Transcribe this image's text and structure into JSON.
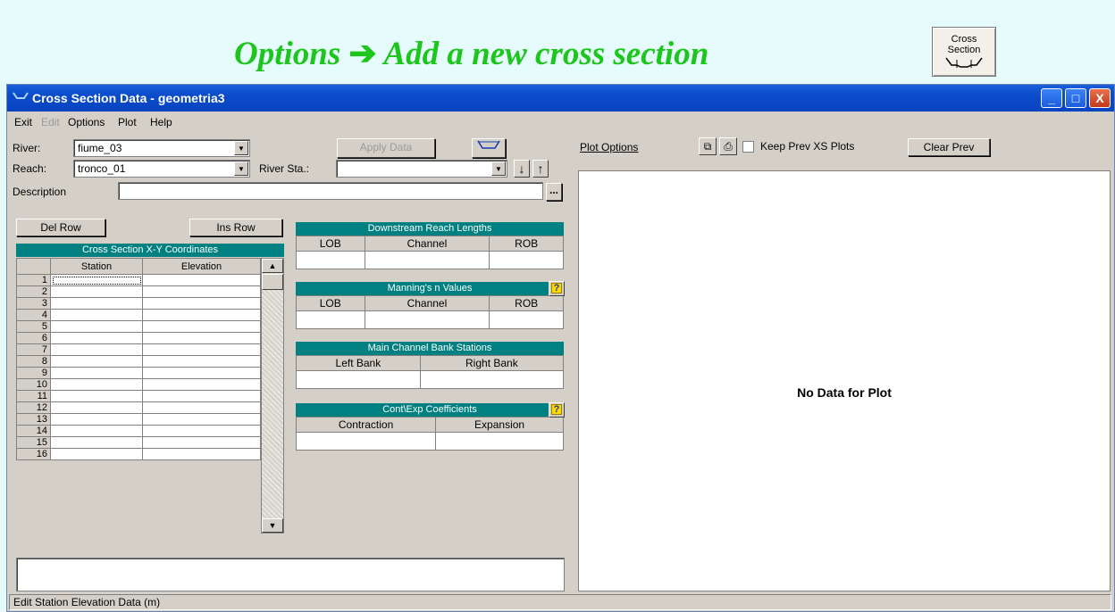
{
  "banner": {
    "part1": "Options ",
    "arrow": "➔",
    "part2": " Add a new cross section",
    "button_line1": "Cross",
    "button_line2": "Section"
  },
  "window": {
    "title": "Cross Section Data - geometria3",
    "minimize": "_",
    "maximize": "□",
    "close": "X"
  },
  "menu": [
    "Exit",
    "Edit",
    "Options",
    "Plot",
    "Help"
  ],
  "form": {
    "river_label": "River:",
    "river_value": "fiume_03",
    "reach_label": "Reach:",
    "reach_value": "tronco_01",
    "river_sta_label": "River Sta.:",
    "river_sta_value": "",
    "apply_label": "Apply Data",
    "description_label": "Description",
    "description_value": "",
    "ellipsis": "...",
    "del_row": "Del Row",
    "ins_row": "Ins Row"
  },
  "grid": {
    "title": "Cross Section X-Y Coordinates",
    "columns": [
      "Station",
      "Elevation"
    ],
    "rows": [
      "1",
      "2",
      "3",
      "4",
      "5",
      "6",
      "7",
      "8",
      "9",
      "10",
      "11",
      "12",
      "13",
      "14",
      "15",
      "16"
    ]
  },
  "reach_lengths": {
    "title": "Downstream Reach Lengths",
    "cols": [
      "LOB",
      "Channel",
      "ROB"
    ]
  },
  "mannings": {
    "title": "Manning's n Values",
    "cols": [
      "LOB",
      "Channel",
      "ROB"
    ],
    "help": "?"
  },
  "bank_stations": {
    "title": "Main Channel Bank Stations",
    "cols": [
      "Left Bank",
      "Right Bank"
    ]
  },
  "coefficients": {
    "title": "Cont\\Exp Coefficients",
    "cols": [
      "Contraction",
      "Expansion"
    ],
    "help": "?"
  },
  "plot": {
    "options_label": "Plot Options",
    "keep_prev": "Keep Prev XS Plots",
    "clear_prev": "Clear Prev",
    "empty_message": "No Data for Plot"
  },
  "status": "Edit Station Elevation Data (m)"
}
